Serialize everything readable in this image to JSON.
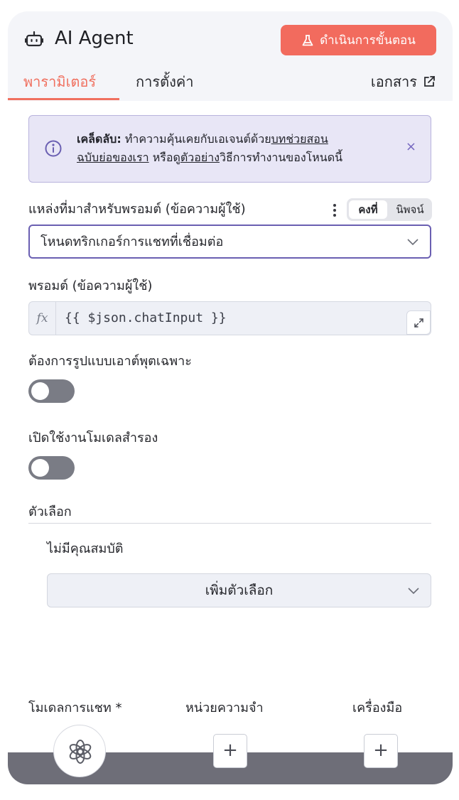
{
  "header": {
    "title": "AI Agent",
    "execute_label": "ดำเนินการขั้นตอน",
    "colors": {
      "accent": "#f26b5e",
      "header_bg": "#f4f5f9"
    }
  },
  "tabs": [
    {
      "label": "พารามิเตอร์",
      "active": true
    },
    {
      "label": "การตั้งค่า",
      "active": false
    }
  ],
  "docs_label": "เอกสาร",
  "tip": {
    "bold": "เคล็ดลับ:",
    "text1": " ทำความคุ้นเคยกับเอเจนต์ด้วย",
    "link1a": "บทช่วยสอน",
    "link1b": "ฉบับย่อของเรา",
    "text2": " หรือดู",
    "link2": "ตัวอย่าง",
    "text3": "วิธีการทำงานของโหนดนี้",
    "close": "×"
  },
  "prompt_source": {
    "label": "แหล่งที่มาสำหรับพรอมต์ (ข้อความผู้ใช้)",
    "mode_fixed": "คงที่",
    "mode_expression": "นิพจน์",
    "value": "โหนดทริกเกอร์การแชทที่เชื่อมต่อ"
  },
  "prompt": {
    "label": "พรอมต์ (ข้อความผู้ใช้)",
    "fx": "fx",
    "value": "{{ $json.chatInput }}"
  },
  "output_format": {
    "label": "ต้องการรูปแบบเอาต์พุตเฉพาะ",
    "enabled": false
  },
  "fallback_model": {
    "label": "เปิดใช้งานโมเดลสำรอง",
    "enabled": false
  },
  "options": {
    "label": "ตัวเลือก",
    "empty": "ไม่มีคุณสมบัติ",
    "add_label": "เพิ่มตัวเลือก"
  },
  "connections": {
    "chat_model": "โมเดลการแชท *",
    "memory": "หน่วยความจำ",
    "tools": "เครื่องมือ",
    "plus": "+"
  }
}
